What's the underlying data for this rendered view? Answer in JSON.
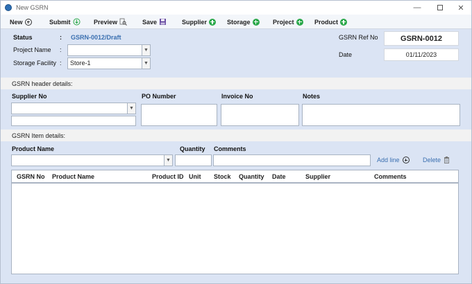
{
  "window": {
    "title": "New GSRN"
  },
  "toolbar": {
    "new": "New",
    "submit": "Submit",
    "preview": "Preview",
    "save": "Save",
    "supplier": "Supplier",
    "storage": "Storage",
    "project": "Project",
    "product": "Product"
  },
  "header": {
    "status_label": "Status",
    "status_sep": ":",
    "status_value": "GSRN-0012/Draft",
    "project_label": "Project Name",
    "project_sep": ":",
    "project_value": "",
    "storage_label": "Storage Facility",
    "storage_sep": ":",
    "storage_value": "Store-1",
    "ref_label": "GSRN Ref No",
    "ref_value": "GSRN-0012",
    "date_label": "Date",
    "date_value": "01/11/2023"
  },
  "gsrn_header": {
    "section_title": "GSRN header details:",
    "supplier_label": "Supplier No",
    "po_label": "PO Number",
    "invoice_label": "Invoice No",
    "notes_label": "Notes"
  },
  "gsrn_items": {
    "section_title": "GSRN Item details:",
    "product_label": "Product Name",
    "quantity_label": "Quantity",
    "comments_label": "Comments",
    "add_line": "Add line",
    "delete": "Delete"
  },
  "grid": {
    "columns": [
      "GSRN No",
      "Product Name",
      "Product ID",
      "Unit",
      "Stock",
      "Quantity",
      "Date",
      "Supplier",
      "Comments"
    ],
    "rows": []
  },
  "colors": {
    "accent": "#3a6fb0",
    "add_green": "#2aa84a",
    "form_bg": "#dbe4f4"
  }
}
